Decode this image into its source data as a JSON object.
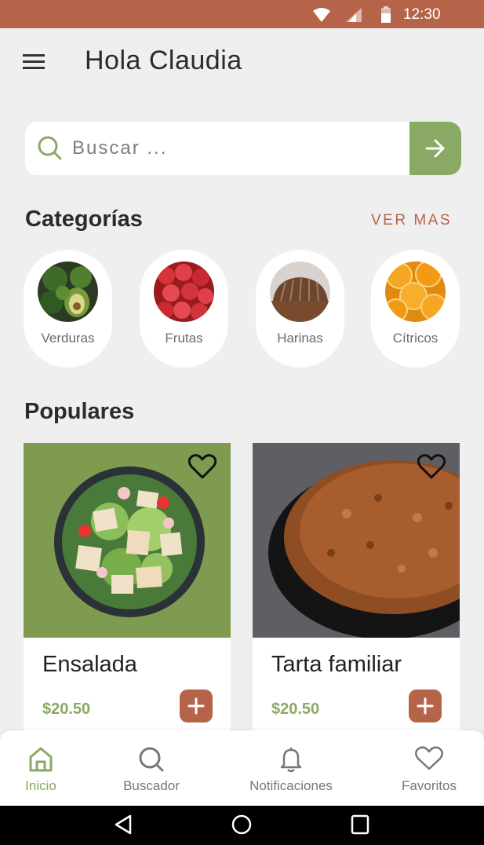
{
  "status_bar": {
    "time": "12:30",
    "icons": [
      "wifi-icon",
      "signal-icon",
      "battery-icon"
    ],
    "background": "#b5644a"
  },
  "header": {
    "greeting": "Hola Claudia",
    "menu_icon": "menu-icon"
  },
  "search": {
    "placeholder": "Buscar ...",
    "value": "",
    "button_icon": "arrow-right-icon"
  },
  "categories": {
    "title": "Categorías",
    "see_more": "VER MAS",
    "items": [
      {
        "label": "Verduras"
      },
      {
        "label": "Frutas"
      },
      {
        "label": "Harinas"
      },
      {
        "label": "Cítricos"
      }
    ]
  },
  "popular": {
    "title": "Populares",
    "items": [
      {
        "name": "Ensalada",
        "price": "$20.50"
      },
      {
        "name": "Tarta familiar",
        "price": "$20.50"
      }
    ]
  },
  "bottom_nav": {
    "items": [
      {
        "label": "Inicio",
        "icon": "home-icon",
        "active": true
      },
      {
        "label": "Buscador",
        "icon": "search-icon",
        "active": false
      },
      {
        "label": "Notificaciones",
        "icon": "bell-icon",
        "active": false
      },
      {
        "label": "Favoritos",
        "icon": "heart-icon",
        "active": false
      }
    ]
  },
  "colors": {
    "accent_green": "#8aa965",
    "accent_terracotta": "#b5644a",
    "background": "#efefef"
  }
}
